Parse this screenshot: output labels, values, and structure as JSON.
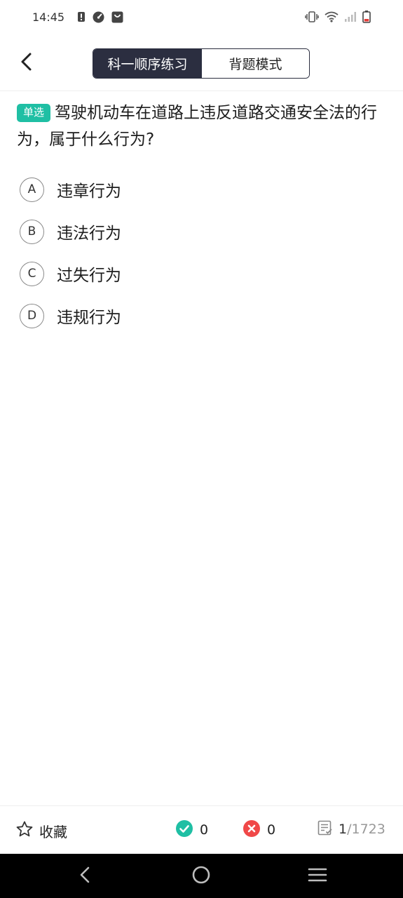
{
  "status_bar": {
    "time": "14:45",
    "icons": [
      "alert-icon",
      "speed-icon",
      "bag-icon",
      "vibrate-icon",
      "wifi-icon",
      "signal-icon",
      "battery-icon"
    ]
  },
  "header": {
    "back_icon": "chevron-left-icon",
    "tabs": [
      {
        "label": "科一顺序练习",
        "active": true
      },
      {
        "label": "背题模式",
        "active": false
      }
    ]
  },
  "question": {
    "type_tag": "单选",
    "text": "驾驶机动车在道路上违反道路交通安全法的行为，属于什么行为?",
    "options": [
      {
        "letter": "A",
        "text": "违章行为"
      },
      {
        "letter": "B",
        "text": "违法行为"
      },
      {
        "letter": "C",
        "text": "过失行为"
      },
      {
        "letter": "D",
        "text": "违规行为"
      }
    ]
  },
  "bottom_bar": {
    "favorite_label": "收藏",
    "correct_count": "0",
    "wrong_count": "0",
    "current": "1",
    "total": "/1723"
  },
  "colors": {
    "accent": "#1fbfa4",
    "tab_active_bg": "#2b2e40",
    "correct": "#1fbfa4",
    "wrong": "#f04848"
  }
}
